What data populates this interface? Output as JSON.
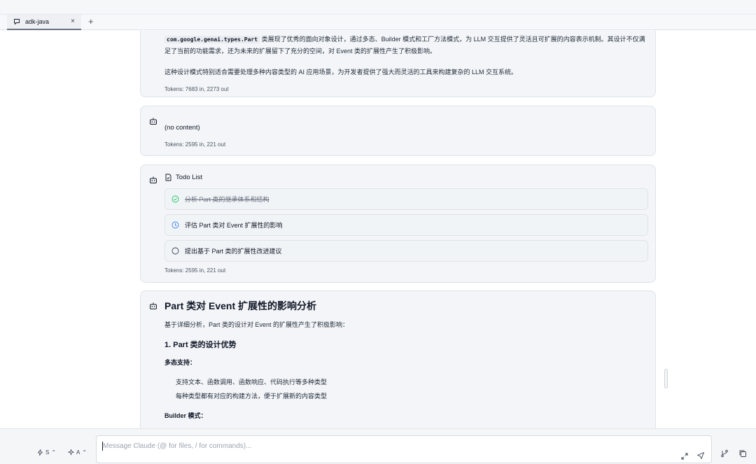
{
  "tabs": [
    {
      "label": "adk-java",
      "close": "×"
    }
  ],
  "new_tab_label": "+",
  "messages": [
    {
      "paragraph1_code": "com.google.genai.types.Part",
      "paragraph1_rest": "类展现了优秀的面向对象设计，通过多态、Builder 模式和工厂方法模式，为 LLM 交互提供了灵活且可扩展的内容表示机制。其设计不仅满足了当前的功能需求，还为未来的扩展留下了充分的空间，对 Event 类的扩展性产生了积极影响。",
      "paragraph2": "这种设计模式特别适合需要处理多种内容类型的 AI 应用场景，为开发者提供了强大而灵活的工具来构建复杂的 LLM 交互系统。",
      "tokens": "Tokens: 7683 in, 2273 out"
    },
    {
      "content": "(no content)",
      "tokens": "Tokens: 2595 in, 221 out"
    },
    {
      "title": "Todo List",
      "items": [
        {
          "label": "分析 Part 类的继承体系和结构",
          "status": "completed"
        },
        {
          "label": "评估 Part 类对 Event 扩展性的影响",
          "status": "in_progress"
        },
        {
          "label": "提出基于 Part 类的扩展性改进建议",
          "status": "pending"
        }
      ],
      "tokens": "Tokens: 2595 in, 221 out"
    },
    {
      "heading": "Part 类对 Event 扩展性的影响分析",
      "intro": "基于详细分析，Part 类的设计对 Event 的扩展性产生了积极影响：",
      "section_heading": "1. Part 类的设计优势",
      "subsection1": "多态支持：",
      "bullets": [
        "支持文本、函数调用、函数响应、代码执行等多种类型",
        "每种类型都有对应的构建方法，便于扩展新的内容类型"
      ],
      "subsection2": "Builder 模式："
    }
  ],
  "bottom": {
    "mode_s": "S",
    "mode_a": "A",
    "placeholder": "Message Claude (@ for files, / for commands)..."
  },
  "colors": {
    "completed": "#22c55e",
    "in_progress": "#3b82f6",
    "pending": "#374151"
  }
}
